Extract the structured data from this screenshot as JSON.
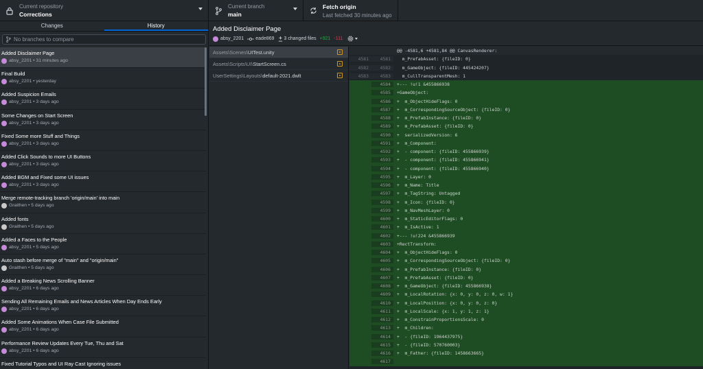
{
  "toolbar": {
    "repo_label": "Current repository",
    "repo_value": "Corrections",
    "branch_label": "Current branch",
    "branch_value": "main",
    "fetch_label": "Fetch origin",
    "fetch_sub": "Last fetched 30 minutes ago"
  },
  "sidebar": {
    "tabs": [
      "Changes",
      "History"
    ],
    "filter_placeholder": "No branches to compare",
    "commits": [
      {
        "title": "Added Disclaimer Page",
        "meta": "absy_2201 • 31 minutes ago",
        "avatar": "purple"
      },
      {
        "title": "Final Build",
        "meta": "absy_2201 • yesterday",
        "avatar": "purple"
      },
      {
        "title": "Added Suspicion Emails",
        "meta": "absy_2201 • 3 days ago",
        "avatar": "purple"
      },
      {
        "title": "Some Changes on Start Screen",
        "meta": "absy_2201 • 3 days ago",
        "avatar": "purple"
      },
      {
        "title": "Fixed Some more Stuff and Things",
        "meta": "absy_2201 • 3 days ago",
        "avatar": "purple"
      },
      {
        "title": "Added Click Sounds to more UI Buttons",
        "meta": "absy_2201 • 3 days ago",
        "avatar": "purple"
      },
      {
        "title": "Added BGM and Fixed some UI issues",
        "meta": "absy_2201 • 3 days ago",
        "avatar": "purple"
      },
      {
        "title": "Merge remote-tracking branch 'origin/main' into main",
        "meta": "Graithen • 5 days ago",
        "avatar": "grey"
      },
      {
        "title": "Added fonts",
        "meta": "Graithen • 5 days ago",
        "avatar": "grey"
      },
      {
        "title": "Added a Faces to the People",
        "meta": "absy_2201 • 5 days ago",
        "avatar": "purple"
      },
      {
        "title": "Auto stash before merge of \"main\" and \"origin/main\"",
        "meta": "Graithen • 5 days ago",
        "avatar": "grey"
      },
      {
        "title": "Added a Breaking News Scrolling Banner",
        "meta": "absy_2201 • 6 days ago",
        "avatar": "purple"
      },
      {
        "title": "Sending All Remaining Emails and News Articles When Day Ends Early",
        "meta": "absy_2201 • 6 days ago",
        "avatar": "purple"
      },
      {
        "title": "Added Some Animations When Case File Submitted",
        "meta": "absy_2201 • 6 days ago",
        "avatar": "purple"
      },
      {
        "title": "Performance Review Updates Every Tue, Thu and Sat",
        "meta": "absy_2201 • 6 days ago",
        "avatar": "purple"
      },
      {
        "title": "Fixed Tutorial Typos and UI Ray Cast Ignoring issues",
        "meta": "",
        "avatar": "purple"
      }
    ]
  },
  "commit_detail": {
    "title": "Added Disclaimer Page",
    "author": "absy_2201",
    "sha": "eade869",
    "files_changed": "3 changed files",
    "additions": "+921",
    "deletions": "-111"
  },
  "files": [
    {
      "path": "Assets\\Scenes\\",
      "name": "UITest.unity"
    },
    {
      "path": "Assets\\Scripts\\UI\\",
      "name": "StartScreen.cs"
    },
    {
      "path": "UserSettings\\Layouts\\",
      "name": "default-2021.dwlt"
    }
  ],
  "diff": [
    {
      "type": "hunk",
      "old": "",
      "new": "",
      "code": "@@ -4581,6 +4581,84 @@ CanvasRenderer:"
    },
    {
      "type": "ctx",
      "old": "4581",
      "new": "4581",
      "code": "  m_PrefabAsset: {fileID: 0}"
    },
    {
      "type": "ctx",
      "old": "4582",
      "new": "4582",
      "code": "  m_GameObject: {fileID: 445424207}"
    },
    {
      "type": "ctx",
      "old": "4583",
      "new": "4583",
      "code": "  m_CullTransparentMesh: 1"
    },
    {
      "type": "add",
      "old": "",
      "new": "4584",
      "code": "+--- !u!1 &455866938"
    },
    {
      "type": "add",
      "old": "",
      "new": "4585",
      "code": "+GameObject:"
    },
    {
      "type": "add",
      "old": "",
      "new": "4586",
      "code": "+  m_ObjectHideFlags: 0"
    },
    {
      "type": "add",
      "old": "",
      "new": "4587",
      "code": "+  m_CorrespondingSourceObject: {fileID: 0}"
    },
    {
      "type": "add",
      "old": "",
      "new": "4588",
      "code": "+  m_PrefabInstance: {fileID: 0}"
    },
    {
      "type": "add",
      "old": "",
      "new": "4589",
      "code": "+  m_PrefabAsset: {fileID: 0}"
    },
    {
      "type": "add",
      "old": "",
      "new": "4590",
      "code": "+  serializedVersion: 6"
    },
    {
      "type": "add",
      "old": "",
      "new": "4591",
      "code": "+  m_Component:"
    },
    {
      "type": "add",
      "old": "",
      "new": "4592",
      "code": "+  - component: {fileID: 455866939}"
    },
    {
      "type": "add",
      "old": "",
      "new": "4593",
      "code": "+  - component: {fileID: 455866941}"
    },
    {
      "type": "add",
      "old": "",
      "new": "4594",
      "code": "+  - component: {fileID: 455866940}"
    },
    {
      "type": "add",
      "old": "",
      "new": "4595",
      "code": "+  m_Layer: 0"
    },
    {
      "type": "add",
      "old": "",
      "new": "4596",
      "code": "+  m_Name: Title"
    },
    {
      "type": "add",
      "old": "",
      "new": "4597",
      "code": "+  m_TagString: Untagged"
    },
    {
      "type": "add",
      "old": "",
      "new": "4598",
      "code": "+  m_Icon: {fileID: 0}"
    },
    {
      "type": "add",
      "old": "",
      "new": "4599",
      "code": "+  m_NavMeshLayer: 0"
    },
    {
      "type": "add",
      "old": "",
      "new": "4600",
      "code": "+  m_StaticEditorFlags: 0"
    },
    {
      "type": "add",
      "old": "",
      "new": "4601",
      "code": "+  m_IsActive: 1"
    },
    {
      "type": "add",
      "old": "",
      "new": "4602",
      "code": "+--- !u!224 &455866939"
    },
    {
      "type": "add",
      "old": "",
      "new": "4603",
      "code": "+RectTransform:"
    },
    {
      "type": "add",
      "old": "",
      "new": "4604",
      "code": "+  m_ObjectHideFlags: 0"
    },
    {
      "type": "add",
      "old": "",
      "new": "4605",
      "code": "+  m_CorrespondingSourceObject: {fileID: 0}"
    },
    {
      "type": "add",
      "old": "",
      "new": "4606",
      "code": "+  m_PrefabInstance: {fileID: 0}"
    },
    {
      "type": "add",
      "old": "",
      "new": "4607",
      "code": "+  m_PrefabAsset: {fileID: 0}"
    },
    {
      "type": "add",
      "old": "",
      "new": "4608",
      "code": "+  m_GameObject: {fileID: 455866938}"
    },
    {
      "type": "add",
      "old": "",
      "new": "4609",
      "code": "+  m_LocalRotation: {x: 0, y: 0, z: 0, w: 1}"
    },
    {
      "type": "add",
      "old": "",
      "new": "4610",
      "code": "+  m_LocalPosition: {x: 0, y: 0, z: 0}"
    },
    {
      "type": "add",
      "old": "",
      "new": "4611",
      "code": "+  m_LocalScale: {x: 1, y: 1, z: 1}"
    },
    {
      "type": "add",
      "old": "",
      "new": "4612",
      "code": "+  m_ConstrainProportionsScale: 0"
    },
    {
      "type": "add",
      "old": "",
      "new": "4613",
      "code": "+  m_Children:"
    },
    {
      "type": "add",
      "old": "",
      "new": "4614",
      "code": "+  - {fileID: 1964437975}"
    },
    {
      "type": "add",
      "old": "",
      "new": "4615",
      "code": "+  - {fileID: 570760003}"
    },
    {
      "type": "add",
      "old": "",
      "new": "4616",
      "code": "+  m_Father: {fileID: 1458663665}"
    },
    {
      "type": "add",
      "old": "",
      "new": "4617",
      "code": ""
    }
  ]
}
